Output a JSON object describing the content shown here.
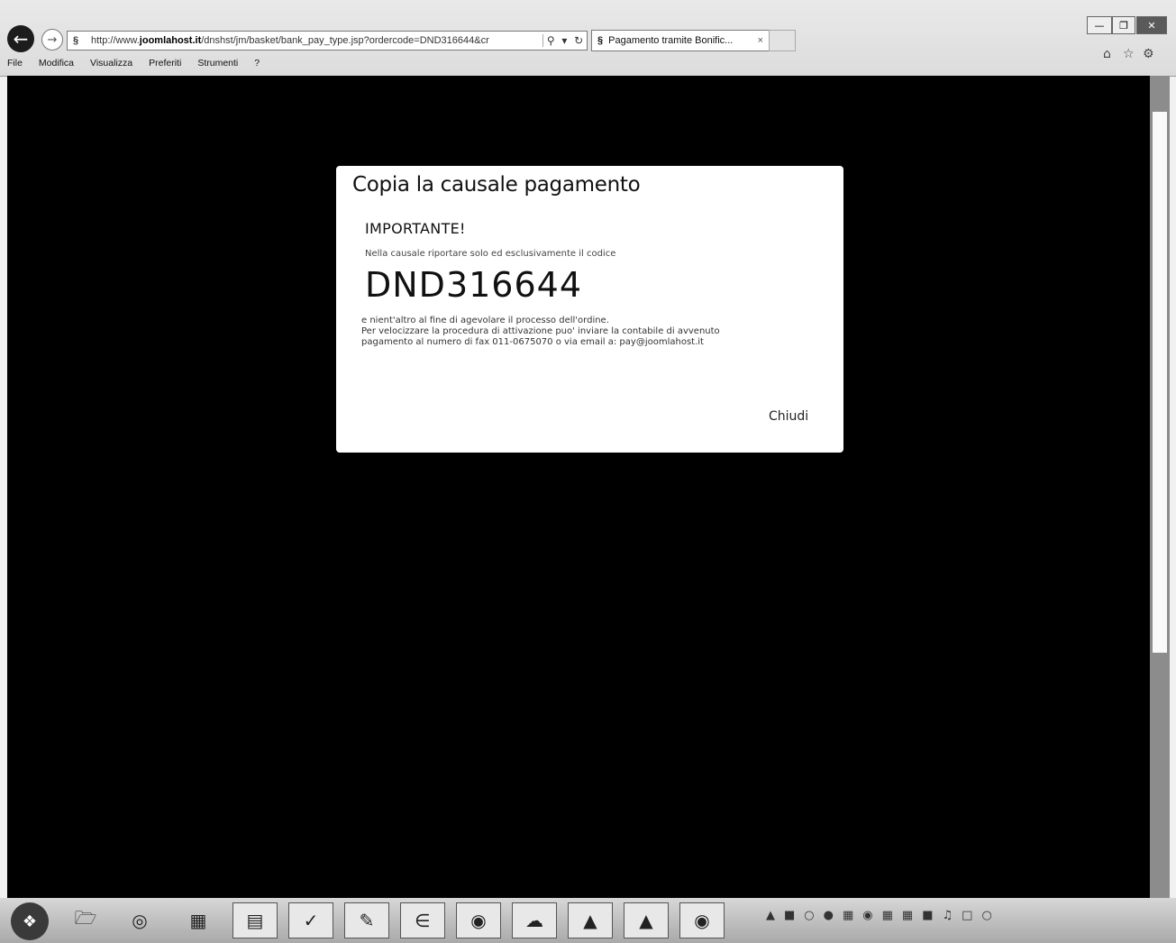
{
  "browser": {
    "url_prefix": "http://www.",
    "url_domain": "joomlahost.it",
    "url_rest": "/dnshst/jm/basket/bank_pay_type.jsp?ordercode=DND316644&cr",
    "tab_title": "Pagamento tramite Bonific...",
    "menu": [
      "File",
      "Modifica",
      "Visualizza",
      "Preferiti",
      "Strumenti",
      "?"
    ]
  },
  "modal": {
    "title": "Copia la causale pagamento",
    "important": "IMPORTANTE!",
    "instruction": "Nella causale riportare solo ed esclusivamente il codice",
    "code": "DND316644",
    "body_lines": [
      "e nient'altro al fine di agevolare il processo dell'ordine.",
      "Per velocizzare la procedura di attivazione puo' inviare la contabile di avvenuto",
      "pagamento al numero di fax 011-0675070 o via email a: pay@joomlahost.it"
    ],
    "close_label": "Chiudi"
  },
  "icons": {
    "back": "back-arrow-icon",
    "forward": "forward-arrow-icon",
    "home": "home-icon",
    "favorites": "star-icon",
    "tools": "gear-icon"
  },
  "colors": {
    "overlay": "#000000",
    "modal_bg": "#ffffff"
  }
}
